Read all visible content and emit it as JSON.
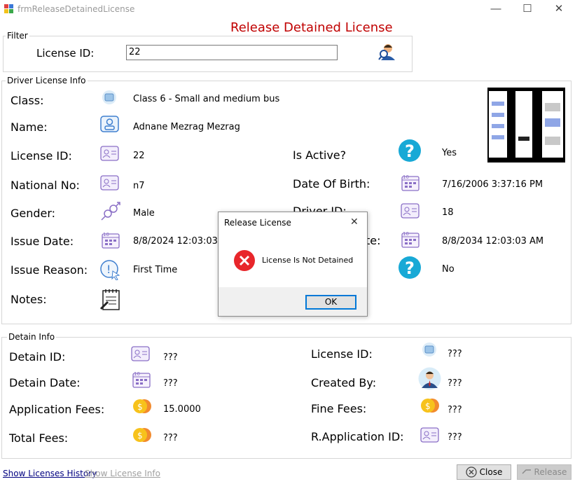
{
  "window": {
    "title": "frmReleaseDetainedLicense",
    "minimize": "—",
    "maximize": "☐",
    "close": "✕"
  },
  "heading": "Release Detained License",
  "filter": {
    "group_title": "Filter",
    "license_id_label": "License ID:",
    "license_id_value": "22"
  },
  "driver_info": {
    "group_title": "Driver License Info",
    "class_label": "Class:",
    "class_value": "Class 6 - Small and medium bus",
    "name_label": "Name:",
    "name_value": "Adnane Mezrag  Mezrag",
    "license_id_label": "License ID:",
    "license_id_value": "22",
    "national_no_label": "National No:",
    "national_no_value": "n7",
    "gender_label": "Gender:",
    "gender_value": "Male",
    "issue_date_label": "Issue Date:",
    "issue_date_value": "8/8/2024 12:03:03 AM",
    "issue_reason_label": "Issue Reason:",
    "issue_reason_value": "First Time",
    "notes_label": "Notes:",
    "is_active_label": "Is Active?",
    "is_active_value": "Yes",
    "dob_label": "Date Of Birth:",
    "dob_value": "7/16/2006 3:37:16 PM",
    "driver_id_label": "Driver ID:",
    "driver_id_value": "18",
    "expiration_label": "te:",
    "expiration_value": "8/8/2034 12:03:03 AM",
    "is_detained_value": "No"
  },
  "detain_info": {
    "group_title": "Detain Info",
    "detain_id_label": "Detain ID:",
    "detain_id_value": "???",
    "detain_date_label": "Detain Date:",
    "detain_date_value": "???",
    "app_fees_label": "Application Fees:",
    "app_fees_value": "15.0000",
    "total_fees_label": "Total Fees:",
    "total_fees_value": "???",
    "license_id_label": "License ID:",
    "license_id_value": "???",
    "created_by_label": "Created By:",
    "created_by_value": "???",
    "fine_fees_label": "Fine Fees:",
    "fine_fees_value": "???",
    "r_app_id_label": "R.Application ID:",
    "r_app_id_value": "???"
  },
  "footer": {
    "show_history": "Show Licenses History",
    "show_info": "Show License Info",
    "close": "Close",
    "release": "Release"
  },
  "dialog": {
    "title": "Release License",
    "message": "License Is Not Detained",
    "ok": "OK",
    "close": "✕"
  },
  "colors": {
    "heading": "#c00000",
    "link": "#000080",
    "disabled": "#a0a0a0",
    "accent": "#0078d7"
  }
}
